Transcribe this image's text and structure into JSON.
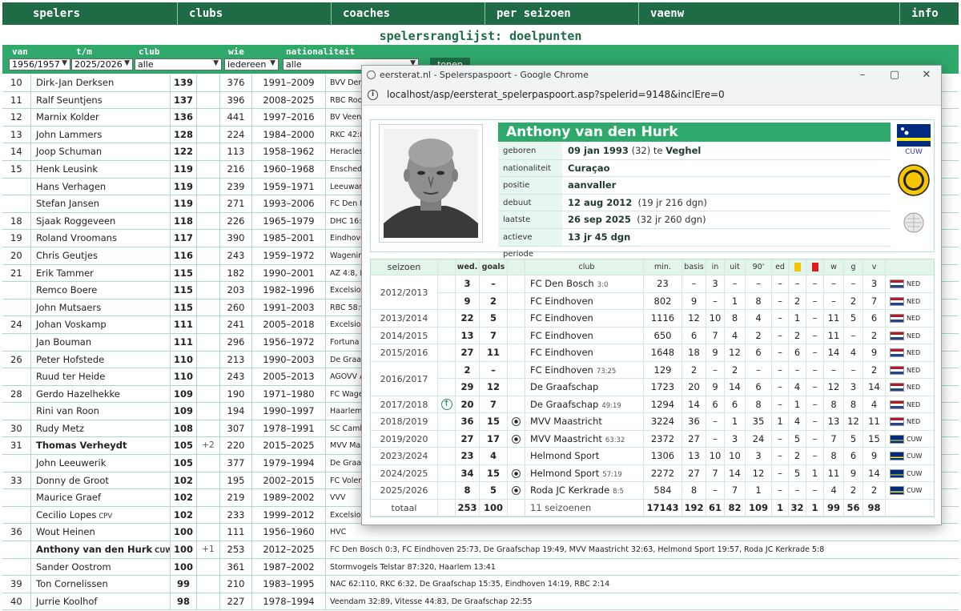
{
  "nav": [
    "spelers",
    "clubs",
    "coaches",
    "per seizoen",
    "vaenw",
    "info"
  ],
  "page_title": "spelersranglijst: doelpunten",
  "filters": {
    "van_label": "van",
    "van_value": "1956/1957",
    "tm_label": "t/m",
    "tm_value": "2025/2026",
    "club_label": "club",
    "club_value": "alle",
    "wie_label": "wie",
    "wie_value": "iedereen",
    "nat_label": "nationaliteit",
    "nat_value": "alle",
    "button": "tonen"
  },
  "ranking": [
    {
      "rank": "10",
      "name": "Dirk-Jan Derksen",
      "nat": "",
      "goals": "139",
      "plus": "",
      "games": "376",
      "period": "1991–2009",
      "clubs": "BVV Den",
      "bold": false
    },
    {
      "rank": "11",
      "name": "Ralf Seuntjens",
      "nat": "",
      "goals": "137",
      "plus": "",
      "games": "396",
      "period": "2008–2025",
      "clubs": "RBC Roos",
      "bold": false
    },
    {
      "rank": "12",
      "name": "Marnix Kolder",
      "nat": "",
      "goals": "136",
      "plus": "",
      "games": "441",
      "period": "1997–2016",
      "clubs": "BV Veen",
      "bold": false
    },
    {
      "rank": "13",
      "name": "John Lammers",
      "nat": "",
      "goals": "128",
      "plus": "",
      "games": "224",
      "period": "1984–2000",
      "clubs": "RKC 42:8",
      "bold": false
    },
    {
      "rank": "14",
      "name": "Joop Schuman",
      "nat": "",
      "goals": "122",
      "plus": "",
      "games": "113",
      "period": "1958–1962",
      "clubs": "Heracles",
      "bold": false
    },
    {
      "rank": "15",
      "name": "Henk Leusink",
      "nat": "",
      "goals": "119",
      "plus": "",
      "games": "216",
      "period": "1960–1968",
      "clubs": "Enschede",
      "bold": false
    },
    {
      "rank": "",
      "name": "Hans Verhagen",
      "nat": "",
      "goals": "119",
      "plus": "",
      "games": "239",
      "period": "1959–1971",
      "clubs": "Leeuwar",
      "bold": false
    },
    {
      "rank": "",
      "name": "Stefan Jansen",
      "nat": "",
      "goals": "119",
      "plus": "",
      "games": "271",
      "period": "1993–2006",
      "clubs": "FC Den B",
      "bold": false
    },
    {
      "rank": "18",
      "name": "Sjaak Roggeveen",
      "nat": "",
      "goals": "118",
      "plus": "",
      "games": "226",
      "period": "1965–1979",
      "clubs": "DHC 16:2",
      "bold": false
    },
    {
      "rank": "19",
      "name": "Roland Vroomans",
      "nat": "",
      "goals": "117",
      "plus": "",
      "games": "390",
      "period": "1985–2001",
      "clubs": "Eindhove",
      "bold": false
    },
    {
      "rank": "20",
      "name": "Chris Geutjes",
      "nat": "",
      "goals": "116",
      "plus": "",
      "games": "243",
      "period": "1959–1972",
      "clubs": "Wagening",
      "bold": false
    },
    {
      "rank": "21",
      "name": "Erik Tammer",
      "nat": "",
      "goals": "115",
      "plus": "",
      "games": "182",
      "period": "1990–2001",
      "clubs": "AZ 4:8, E",
      "bold": false
    },
    {
      "rank": "",
      "name": "Remco Boere",
      "nat": "",
      "goals": "115",
      "plus": "",
      "games": "203",
      "period": "1982–1996",
      "clubs": "Excelsior",
      "bold": false
    },
    {
      "rank": "",
      "name": "John Mutsaers",
      "nat": "",
      "goals": "115",
      "plus": "",
      "games": "260",
      "period": "1991–2003",
      "clubs": "RBC 58:9",
      "bold": false
    },
    {
      "rank": "24",
      "name": "Johan Voskamp",
      "nat": "",
      "goals": "111",
      "plus": "",
      "games": "241",
      "period": "2005–2018",
      "clubs": "Excelsior",
      "bold": false
    },
    {
      "rank": "",
      "name": "Jan Bouman",
      "nat": "",
      "goals": "111",
      "plus": "",
      "games": "296",
      "period": "1956–1972",
      "clubs": "Fortuna V",
      "bold": false
    },
    {
      "rank": "26",
      "name": "Peter Hofstede",
      "nat": "",
      "goals": "110",
      "plus": "",
      "games": "213",
      "period": "1990–2003",
      "clubs": "De Graaf",
      "bold": false
    },
    {
      "rank": "",
      "name": "Ruud ter Heide",
      "nat": "",
      "goals": "110",
      "plus": "",
      "games": "243",
      "period": "2005–2013",
      "clubs": "AGOVV A",
      "bold": false
    },
    {
      "rank": "28",
      "name": "Gerdo Hazelhekke",
      "nat": "",
      "goals": "109",
      "plus": "",
      "games": "190",
      "period": "1971–1980",
      "clubs": "FC Wager",
      "bold": false
    },
    {
      "rank": "",
      "name": "Rini van Roon",
      "nat": "",
      "goals": "109",
      "plus": "",
      "games": "194",
      "period": "1990–1997",
      "clubs": "Haarlem",
      "bold": false
    },
    {
      "rank": "30",
      "name": "Rudy Metz",
      "nat": "",
      "goals": "108",
      "plus": "",
      "games": "307",
      "period": "1978–1991",
      "clubs": "SC Camb",
      "bold": false
    },
    {
      "rank": "31",
      "name": "Thomas Verheydt",
      "nat": "",
      "goals": "105",
      "plus": "+2",
      "games": "220",
      "period": "2015–2025",
      "clubs": "MVV Maa",
      "bold": true
    },
    {
      "rank": "",
      "name": "John Leeuwerik",
      "nat": "",
      "goals": "105",
      "plus": "",
      "games": "377",
      "period": "1979–1994",
      "clubs": "De Graaf",
      "bold": false
    },
    {
      "rank": "33",
      "name": "Donny de Groot",
      "nat": "",
      "goals": "102",
      "plus": "",
      "games": "195",
      "period": "2002–2015",
      "clubs": "FC Volen",
      "bold": false
    },
    {
      "rank": "",
      "name": "Maurice Graef",
      "nat": "",
      "goals": "102",
      "plus": "",
      "games": "219",
      "period": "1989–2002",
      "clubs": "VVV",
      "bold": false
    },
    {
      "rank": "",
      "name": "Cecilio Lopes",
      "nat": "CPV",
      "goals": "102",
      "plus": "",
      "games": "233",
      "period": "1999–2012",
      "clubs": "Excelsior",
      "bold": false
    },
    {
      "rank": "36",
      "name": "Wout Heinen",
      "nat": "",
      "goals": "100",
      "plus": "",
      "games": "111",
      "period": "1956–1960",
      "clubs": "HVC",
      "bold": false
    },
    {
      "rank": "",
      "name": "Anthony van den Hurk",
      "nat": "CUW",
      "goals": "100",
      "plus": "+1",
      "games": "253",
      "period": "2012–2025",
      "clubs": "FC Den Bosch 0:3, FC Eindhoven 25:73, De Graafschap 19:49, MVV Maastricht 32:63, Helmond Sport 19:57, Roda JC Kerkrade 5:8",
      "bold": true
    },
    {
      "rank": "",
      "name": "Sander Oostrom",
      "nat": "",
      "goals": "100",
      "plus": "",
      "games": "361",
      "period": "1987–2002",
      "clubs": "Stormvogels Telstar 87:320, Haarlem 13:41",
      "bold": false
    },
    {
      "rank": "39",
      "name": "Ton Cornelissen",
      "nat": "",
      "goals": "99",
      "plus": "",
      "games": "210",
      "period": "1983–1995",
      "clubs": "NAC 62:110, RKC 6:32, De Graafschap 15:35, Eindhoven 14:19, RBC 2:14",
      "bold": false
    },
    {
      "rank": "40",
      "name": "Jurrie Koolhof",
      "nat": "",
      "goals": "98",
      "plus": "",
      "games": "227",
      "period": "1978–1994",
      "clubs": "Veendam 32:89, Vitesse 44:83, De Graafschap 22:55",
      "bold": false
    }
  ],
  "popup": {
    "window_title": "eersterat.nl - Spelerspaspoort - Google Chrome",
    "url": "localhost/asp/eersterat_spelerpaspoort.asp?spelerid=9148&inclEre=0",
    "player": {
      "name": "Anthony van den Hurk",
      "rows": [
        {
          "label": "geboren",
          "value": "09 jan 1993",
          "extra": " (32) te ",
          "extra_bold": "Veghel"
        },
        {
          "label": "nationaliteit",
          "value": "Curaçao",
          "extra": "",
          "extra_bold": ""
        },
        {
          "label": "positie",
          "value": "aanvaller",
          "extra": "",
          "extra_bold": ""
        },
        {
          "label": "debuut",
          "value": "12 aug 2012",
          "extra": "  (19 jr 216 dgn)",
          "extra_bold": ""
        },
        {
          "label": "laatste wedstrijd",
          "value": "26 sep 2025",
          "extra": "  (32 jr 260 dgn)",
          "extra_bold": ""
        },
        {
          "label": "actieve periode",
          "value": "13 jr 45 dgn",
          "extra": "",
          "extra_bold": ""
        }
      ],
      "flag_label": "CUW"
    },
    "headers": {
      "season": "seizoen",
      "wed": "wed.",
      "goals": "goals",
      "club": "club",
      "min": "min.",
      "basis": "basis",
      "in": "in",
      "uit": "uit",
      "n90": "90'",
      "ed": "ed",
      "w": "w",
      "g": "g",
      "v": "v"
    },
    "seasons": [
      {
        "season": "2012/2013",
        "mark": "",
        "wed": "3",
        "goals": "–",
        "ball": false,
        "club": "FC Den Bosch",
        "score": "3:0",
        "min": "23",
        "basis": "–",
        "in": "3",
        "uit": "–",
        "n90": "–",
        "ed": "–",
        "yel": "–",
        "red": "–",
        "w": "–",
        "g": "–",
        "v": "3",
        "nat": "NED"
      },
      {
        "season": "",
        "mark": "",
        "wed": "9",
        "goals": "2",
        "ball": false,
        "club": "FC Eindhoven",
        "score": "",
        "min": "802",
        "basis": "9",
        "in": "–",
        "uit": "1",
        "n90": "8",
        "ed": "–",
        "yel": "2",
        "red": "–",
        "w": "–",
        "g": "2",
        "v": "7",
        "nat": "NED"
      },
      {
        "season": "2013/2014",
        "mark": "",
        "wed": "22",
        "goals": "5",
        "ball": false,
        "club": "FC Eindhoven",
        "score": "",
        "min": "1116",
        "basis": "12",
        "in": "10",
        "uit": "8",
        "n90": "4",
        "ed": "–",
        "yel": "1",
        "red": "–",
        "w": "11",
        "g": "5",
        "v": "6",
        "nat": "NED"
      },
      {
        "season": "2014/2015",
        "mark": "",
        "wed": "13",
        "goals": "7",
        "ball": false,
        "club": "FC Eindhoven",
        "score": "",
        "min": "650",
        "basis": "6",
        "in": "7",
        "uit": "4",
        "n90": "2",
        "ed": "–",
        "yel": "2",
        "red": "–",
        "w": "11",
        "g": "–",
        "v": "2",
        "nat": "NED"
      },
      {
        "season": "2015/2016",
        "mark": "",
        "wed": "27",
        "goals": "11",
        "ball": false,
        "club": "FC Eindhoven",
        "score": "",
        "min": "1648",
        "basis": "18",
        "in": "9",
        "uit": "12",
        "n90": "6",
        "ed": "–",
        "yel": "6",
        "red": "–",
        "w": "14",
        "g": "4",
        "v": "9",
        "nat": "NED"
      },
      {
        "season": "2016/2017",
        "mark": "",
        "wed": "2",
        "goals": "–",
        "ball": false,
        "club": "FC Eindhoven",
        "score": "73:25",
        "min": "129",
        "basis": "2",
        "in": "–",
        "uit": "2",
        "n90": "–",
        "ed": "–",
        "yel": "–",
        "red": "–",
        "w": "–",
        "g": "–",
        "v": "2",
        "nat": "NED"
      },
      {
        "season": "",
        "mark": "",
        "wed": "29",
        "goals": "12",
        "ball": false,
        "club": "De Graafschap",
        "score": "",
        "min": "1723",
        "basis": "20",
        "in": "9",
        "uit": "14",
        "n90": "6",
        "ed": "–",
        "yel": "4",
        "red": "–",
        "w": "12",
        "g": "3",
        "v": "14",
        "nat": "NED"
      },
      {
        "season": "2017/2018",
        "mark": "up",
        "wed": "20",
        "goals": "7",
        "ball": false,
        "club": "De Graafschap",
        "score": "49:19",
        "min": "1294",
        "basis": "14",
        "in": "6",
        "uit": "6",
        "n90": "8",
        "ed": "–",
        "yel": "1",
        "red": "–",
        "w": "8",
        "g": "8",
        "v": "4",
        "nat": "NED"
      },
      {
        "season": "2018/2019",
        "mark": "",
        "wed": "36",
        "goals": "15",
        "ball": true,
        "club": "MVV Maastricht",
        "score": "",
        "min": "3224",
        "basis": "36",
        "in": "–",
        "uit": "1",
        "n90": "35",
        "ed": "1",
        "yel": "4",
        "red": "–",
        "w": "13",
        "g": "12",
        "v": "11",
        "nat": "NED"
      },
      {
        "season": "2019/2020",
        "mark": "",
        "wed": "27",
        "goals": "17",
        "ball": true,
        "club": "MVV Maastricht",
        "score": "63:32",
        "min": "2372",
        "basis": "27",
        "in": "–",
        "uit": "3",
        "n90": "24",
        "ed": "–",
        "yel": "5",
        "red": "–",
        "w": "7",
        "g": "5",
        "v": "15",
        "nat": "CUW"
      },
      {
        "season": "2023/2024",
        "mark": "",
        "wed": "23",
        "goals": "4",
        "ball": false,
        "club": "Helmond Sport",
        "score": "",
        "min": "1306",
        "basis": "13",
        "in": "10",
        "uit": "10",
        "n90": "3",
        "ed": "–",
        "yel": "2",
        "red": "–",
        "w": "8",
        "g": "6",
        "v": "9",
        "nat": "CUW"
      },
      {
        "season": "2024/2025",
        "mark": "",
        "wed": "34",
        "goals": "15",
        "ball": true,
        "club": "Helmond Sport",
        "score": "57:19",
        "min": "2272",
        "basis": "27",
        "in": "7",
        "uit": "14",
        "n90": "12",
        "ed": "–",
        "yel": "5",
        "red": "1",
        "w": "11",
        "g": "9",
        "v": "14",
        "nat": "CUW"
      },
      {
        "season": "2025/2026",
        "mark": "",
        "wed": "8",
        "goals": "5",
        "ball": true,
        "club": "Roda JC Kerkrade",
        "score": "8:5",
        "min": "584",
        "basis": "8",
        "in": "–",
        "uit": "7",
        "n90": "1",
        "ed": "–",
        "yel": "–",
        "red": "–",
        "w": "4",
        "g": "2",
        "v": "2",
        "nat": "CUW"
      }
    ],
    "totals": {
      "label": "totaal",
      "wed": "253",
      "goals": "100",
      "club": "11 seizoenen",
      "min": "17143",
      "basis": "192",
      "in": "61",
      "uit": "82",
      "n90": "109",
      "ed": "1",
      "yel": "32",
      "red": "1",
      "w": "99",
      "g": "56",
      "v": "98"
    }
  },
  "colors": {
    "dark_green": "#1e6b45",
    "green": "#2fa86b",
    "light_green": "#e3f5ea"
  }
}
